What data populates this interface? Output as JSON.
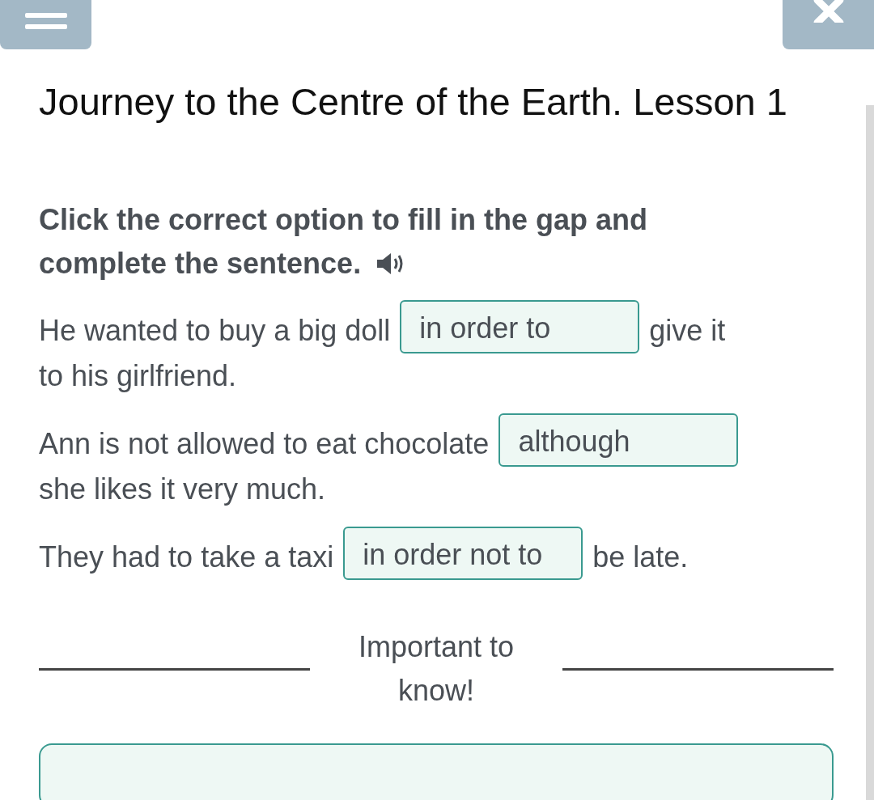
{
  "title": "Journey to the Centre of the Earth. Lesson 1",
  "instruction_lines": [
    "Click the correct option to fill in the gap and",
    "complete the sentence."
  ],
  "sentences": [
    {
      "before": "He wanted to buy a big doll",
      "answer": "in order to",
      "after": "give it",
      "continuation": "to his girlfriend."
    },
    {
      "before": "Ann is not allowed to eat chocolate",
      "answer": "although",
      "continuation": "she likes it very much."
    },
    {
      "before": "They had to take a taxi",
      "answer": "in order not to",
      "after": "be late."
    }
  ],
  "note_heading": "Important to know!"
}
